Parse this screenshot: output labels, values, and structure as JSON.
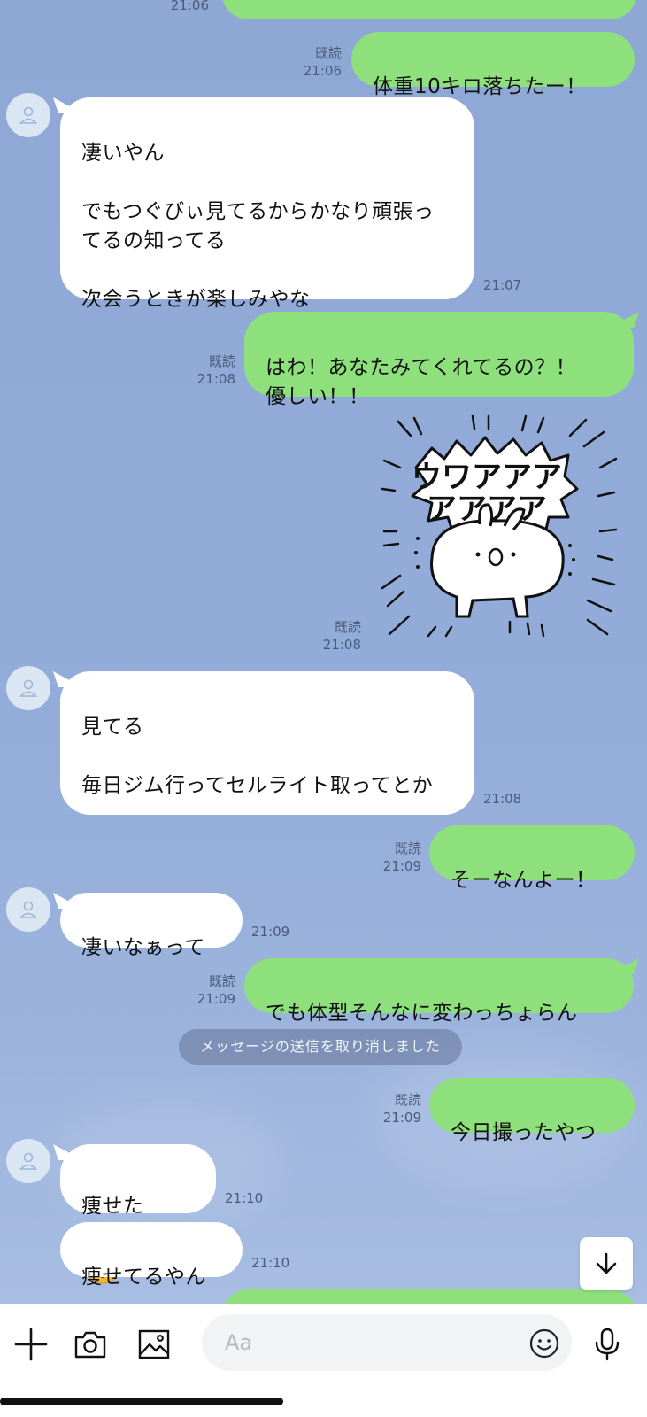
{
  "read_label": "既読",
  "messages": {
    "m0": {
      "time": "21:06"
    },
    "m1": {
      "text": "体重10キロ落ちたー！",
      "time": "21:06"
    },
    "m2": {
      "text": "凄いやん\n\nでもつぐびぃ見てるからかなり頑張ってるの知ってる\n\n次会うときが楽しみやな",
      "time": "21:07"
    },
    "m3": {
      "text": "はわ！あなたみてくれてるの？！\n優しい！！",
      "time": "21:08"
    },
    "m4": {
      "sticker_text": "ウワアアア\nアアアア",
      "time": "21:08"
    },
    "m5": {
      "text": "見てる\n\n毎日ジム行ってセルライト取ってとか",
      "time": "21:08"
    },
    "m6": {
      "text": "そーなんよー！",
      "time": "21:09"
    },
    "m7": {
      "text": "凄いなぁって",
      "time": "21:09"
    },
    "m8": {
      "text": "でも体型そんなに変わっちょらん",
      "time": "21:09"
    },
    "m9": {
      "text": "今日撮ったやつ",
      "time": "21:09"
    },
    "m10": {
      "text": "痩せた",
      "emoji": "astonished-face",
      "time": "21:10"
    },
    "m11": {
      "text": "痩せてるやん",
      "time": "21:10"
    }
  },
  "system_notice": "メッセージの送信を取り消しました",
  "input": {
    "placeholder": "Aa"
  },
  "icons": [
    "plus-icon",
    "camera-icon",
    "image-icon",
    "emoji-icon",
    "microphone-icon",
    "arrow-down-icon",
    "person-icon"
  ],
  "colors": {
    "background": "#8fa8d6",
    "outgoing": "#8de07c",
    "incoming": "#ffffff"
  }
}
